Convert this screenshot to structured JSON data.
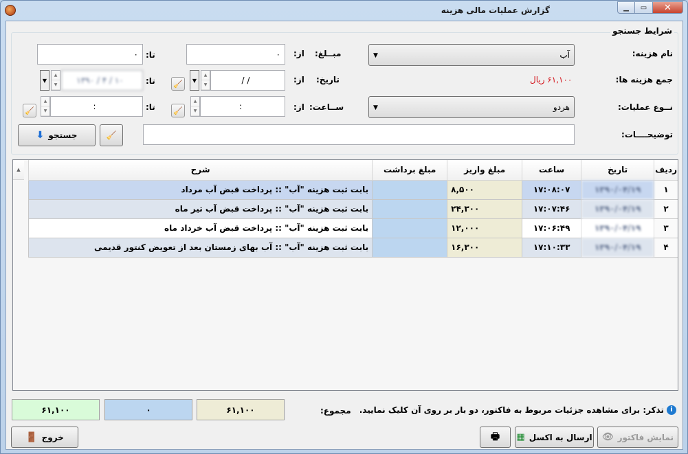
{
  "window": {
    "title": "گزارش عملیات مالی هزینه"
  },
  "search": {
    "group_title": "شرایط جستجو",
    "expense_name_label": "نام هزینه:",
    "expense_name_value": "آب",
    "total_label": "جمع هزینه ها:",
    "total_value": "۶۱,۱۰۰ ریال",
    "operation_type_label": "نــوع عملیات:",
    "operation_type_value": "هردو",
    "description_label": "توضیحــــات:",
    "amount_label": "مبــلغ:",
    "date_label": "تاریخ:",
    "time_label": "ســاعت:",
    "from_label": "از:",
    "to_label": "تا:",
    "amount_from_value": "۰",
    "amount_to_value": "۰",
    "date_from_value": "/      /",
    "date_to_value": "۱۳۹۰ / ۴ / ۱۰",
    "time_from_value": ":",
    "time_to_value": ":",
    "search_button": "جستجو"
  },
  "grid": {
    "columns": [
      "ردیف",
      "تاریخ",
      "ساعت",
      "مبلغ واریز",
      "مبلغ برداشت",
      "شرح"
    ],
    "rows": [
      {
        "index": "۱",
        "date": "۱۳۹۰/۰۴/۱۹",
        "time": "۱۷:۰۸:۰۷",
        "deposit": "۸,۵۰۰",
        "withdrawal": "",
        "description": "بابت ثبت هزینه \"آب\" :: پرداخت قبض آب مرداد"
      },
      {
        "index": "۲",
        "date": "۱۳۹۰/۰۴/۱۹",
        "time": "۱۷:۰۷:۴۶",
        "deposit": "۲۴,۳۰۰",
        "withdrawal": "",
        "description": "بابت ثبت هزینه \"آب\" :: پرداخت قبض آب تیر ماه"
      },
      {
        "index": "۳",
        "date": "۱۳۹۰/۰۴/۱۹",
        "time": "۱۷:۰۶:۴۹",
        "deposit": "۱۲,۰۰۰",
        "withdrawal": "",
        "description": "بابت ثبت هزینه \"آب\" :: پرداخت قبض آب خرداد ماه"
      },
      {
        "index": "۴",
        "date": "۱۳۹۰/۰۴/۱۹",
        "time": "۱۷:۱۰:۳۳",
        "deposit": "۱۶,۳۰۰",
        "withdrawal": "",
        "description": "بابت ثبت هزینه \"آب\" :: آب بهای زمستان بعد از تعویض کنتور قدیمی"
      }
    ]
  },
  "footer": {
    "note": "تذکر: برای مشاهده جزئیات مربوط به فاکتور، دو بار بر روی آن کلیک نمایید.",
    "sum_label": "مجموع:",
    "deposit_total": "۶۱,۱۰۰",
    "withdrawal_total": "۰",
    "balance_total": "۶۱,۱۰۰",
    "exit_button": "خروج",
    "excel_button": "ارسال به اکسل",
    "show_invoice_button": "نمایش فاکتور"
  },
  "colors": {
    "total_red": "#d4141b",
    "deposit_bg": "#eeecd6",
    "withdraw_bg": "#bcd6f0",
    "balance_bg": "#d9fbd9"
  }
}
